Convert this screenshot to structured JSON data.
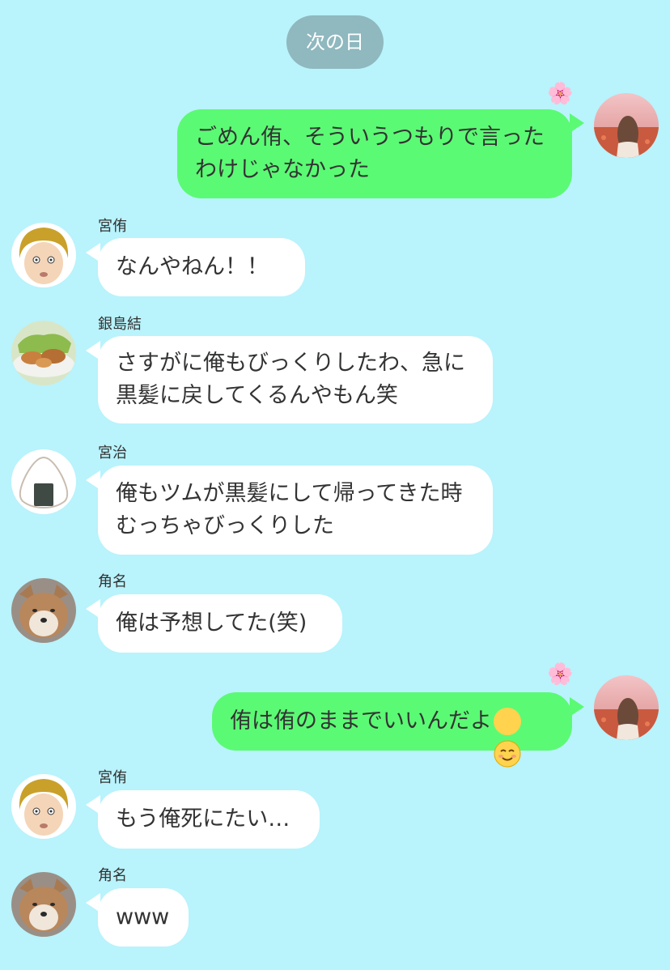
{
  "date_divider": "次の日",
  "colors": {
    "background": "#b9f3fc",
    "outgoing_bubble": "#5bfa74",
    "incoming_bubble": "#ffffff",
    "date_pill": "#8fb8bf"
  },
  "decoration_icon": "cherry-blossom-icon",
  "messages": [
    {
      "direction": "outgoing",
      "text": "ごめん侑、そういうつもりで言ったわけじゃなかった",
      "avatar_icon": "girl-in-flower-field-avatar"
    },
    {
      "direction": "incoming",
      "sender": "宮侑",
      "text": "なんやねん！！",
      "avatar_icon": "blond-boy-avatar"
    },
    {
      "direction": "incoming",
      "sender": "銀島結",
      "text": "さすがに俺もびっくりしたわ、急に黒髪に戻してくるんやもん笑",
      "avatar_icon": "food-plate-avatar"
    },
    {
      "direction": "incoming",
      "sender": "宮治",
      "text": "俺もツムが黒髪にして帰ってきた時むっちゃびっくりした",
      "avatar_icon": "onigiri-avatar"
    },
    {
      "direction": "incoming",
      "sender": "角名",
      "text": "俺は予想してた(笑)",
      "avatar_icon": "shiba-dog-avatar"
    },
    {
      "direction": "outgoing",
      "text": "侑は侑のままでいいんだよ",
      "emoji": "smiling-face-emoji",
      "avatar_icon": "girl-in-flower-field-avatar"
    },
    {
      "direction": "incoming",
      "sender": "宮侑",
      "text": "もう俺死にたい…",
      "avatar_icon": "blond-boy-avatar"
    },
    {
      "direction": "incoming",
      "sender": "角名",
      "text": "www",
      "avatar_icon": "shiba-dog-avatar"
    }
  ]
}
